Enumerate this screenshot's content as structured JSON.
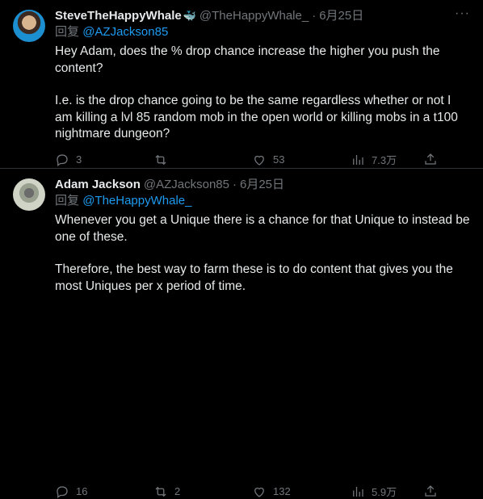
{
  "tweets": [
    {
      "name": "SteveTheHappyWhale",
      "badge": "🐳",
      "handle": "@TheHappyWhale_",
      "sep": "·",
      "date": "6月25日",
      "reply_label": "回复",
      "reply_to": "@AZJackson85",
      "paragraphs": [
        "Hey Adam, does the % drop chance increase the higher you push the content?",
        "I.e. is the drop chance going to be the same regardless whether or not I am killing a lvl 85 random mob in the open world or killing mobs in a t100 nightmare dungeon?"
      ],
      "replies": "3",
      "retweets": "",
      "likes": "53",
      "views": "7.3万"
    },
    {
      "name": "Adam Jackson",
      "handle": "@AZJackson85",
      "sep": "·",
      "date": "6月25日",
      "reply_label": "回复",
      "reply_to": "@TheHappyWhale_",
      "paragraphs": [
        "Whenever you get a Unique there is a chance for that Unique to instead be one of these.",
        "Therefore, the best way to farm these is to do content that gives you the most Uniques per x period of time."
      ],
      "replies": "16",
      "retweets": "2",
      "likes": "132",
      "views": "5.9万"
    }
  ],
  "more_glyph": "···",
  "icons": [
    "reply-icon",
    "retweet-icon",
    "like-icon",
    "views-icon",
    "share-icon"
  ]
}
